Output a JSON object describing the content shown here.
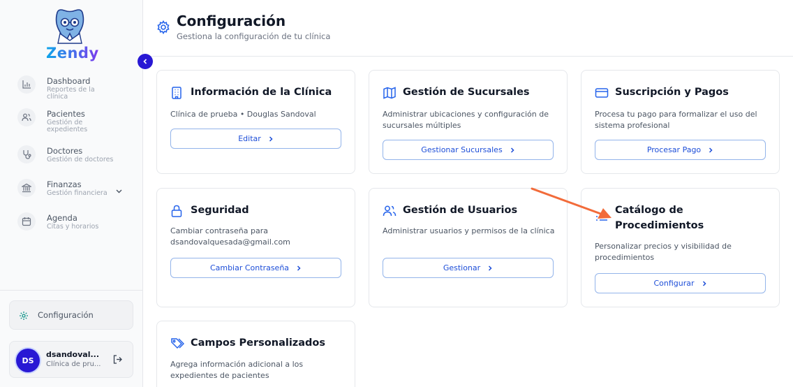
{
  "app": {
    "logo_text": "Zendy"
  },
  "sidebar": {
    "items": [
      {
        "label": "Dashboard",
        "sub": "Reportes de la clínica",
        "icon": "bar-chart-icon"
      },
      {
        "label": "Pacientes",
        "sub": "Gestión de expedientes",
        "icon": "users-icon"
      },
      {
        "label": "Doctores",
        "sub": "Gestión de doctores",
        "icon": "stethoscope-icon"
      },
      {
        "label": "Finanzas",
        "sub": "Gestión financiera",
        "icon": "bank-icon"
      },
      {
        "label": "Agenda",
        "sub": "Citas y horarios",
        "icon": "calendar-icon"
      }
    ],
    "config_label": "Configuración",
    "user": {
      "initials": "DS",
      "name": "dsandoval...",
      "sub": "Clínica de pru..."
    }
  },
  "header": {
    "title": "Configuración",
    "subtitle": "Gestiona la configuración de tu clínica"
  },
  "cards": [
    {
      "title": "Información de la Clínica",
      "desc": "Clínica de prueba • Douglas Sandoval",
      "button": "Editar",
      "icon": "building-icon"
    },
    {
      "title": "Gestión de Sucursales",
      "desc": "Administrar ubicaciones y configuración de sucursales múltiples",
      "button": "Gestionar Sucursales",
      "icon": "map-icon"
    },
    {
      "title": "Suscripción y Pagos",
      "desc": "Procesa tu pago para formalizar el uso del sistema profesional",
      "button": "Procesar Pago",
      "icon": "credit-card-icon"
    },
    {
      "title": "Seguridad",
      "desc": "Cambiar contraseña para dsandovalquesada@gmail.com",
      "button": "Cambiar Contraseña",
      "icon": "lock-icon"
    },
    {
      "title": "Gestión de Usuarios",
      "desc": "Administrar usuarios y permisos de la clínica",
      "button": "Gestionar",
      "icon": "users-icon"
    },
    {
      "title": "Catálogo de Procedimientos",
      "desc": "Personalizar precios y visibilidad de procedimientos",
      "button": "Configurar",
      "icon": "list-icon"
    },
    {
      "title": "Campos Personalizados",
      "desc": "Agrega información adicional a los expedientes de pacientes",
      "icon": "tags-icon"
    }
  ],
  "colors": {
    "accent": "#2818d4",
    "link": "#1d4ed8",
    "annotation_arrow": "#f26b3a"
  }
}
